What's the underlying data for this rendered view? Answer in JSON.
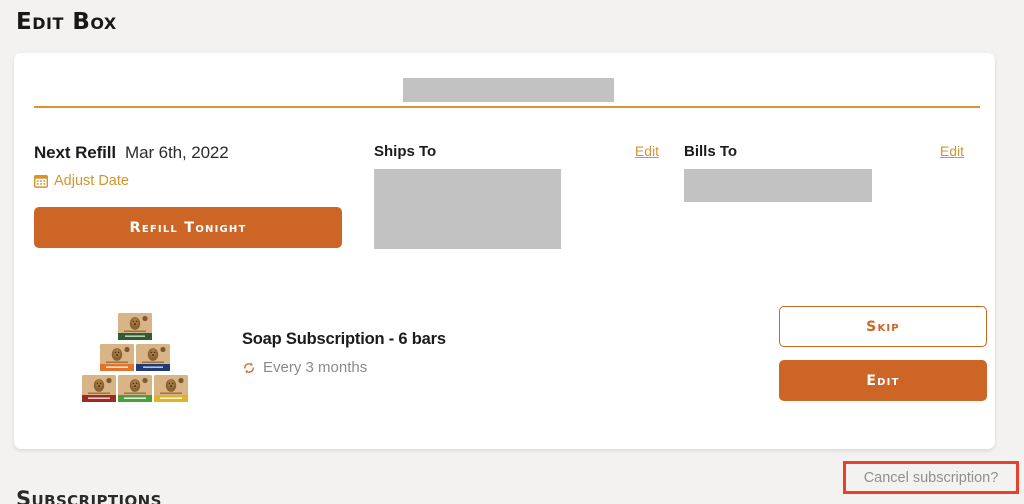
{
  "page": {
    "title": "Edit Box",
    "bottom_heading_clipped": "Subscriptions"
  },
  "colors": {
    "page_background": "#f3f2f0",
    "card_background": "#ffffff",
    "primary_orange": "#cc6526",
    "gold_link": "#d2952f",
    "divider": "#d9952f",
    "redaction_gray": "#c2c2c2",
    "annotation_red": "#e8402a",
    "muted_text": "#8a8a8a"
  },
  "card": {
    "top_redaction": "redacted-bar",
    "refill": {
      "label": "Next Refill",
      "date": "Mar 6th, 2022",
      "adjust_icon": "calendar-icon",
      "adjust_label": "Adjust Date",
      "refill_button_label": "Refill Tonight"
    },
    "ships_to": {
      "title": "Ships To",
      "edit_label": "Edit",
      "value_redacted": "redacted-address"
    },
    "bills_to": {
      "title": "Bills To",
      "edit_label": "Edit",
      "value_redacted": "redacted-address"
    },
    "product": {
      "image_alt": "soap-boxes-pyramid",
      "name": "Soap Subscription - 6 bars",
      "frequency_icon": "recurring-icon",
      "frequency": "Every 3 months",
      "skip_label": "Skip",
      "edit_label": "Edit"
    }
  },
  "cancel": {
    "label": "Cancel subscription?",
    "highlight": "red-annotation-box"
  }
}
